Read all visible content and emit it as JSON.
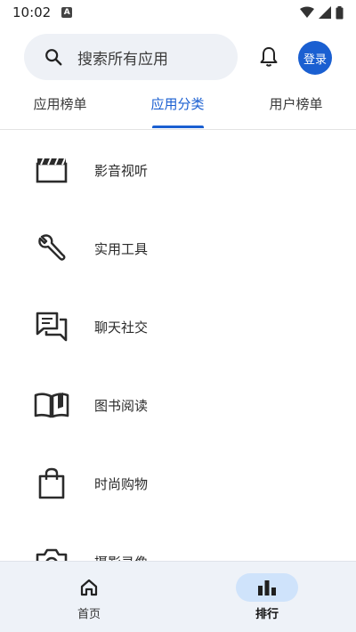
{
  "status_bar": {
    "time": "10:02",
    "notification_glyph": "A"
  },
  "search": {
    "placeholder_text": "搜索所有应用"
  },
  "header": {
    "login_label": "登录"
  },
  "tabs": [
    {
      "label": "应用榜单"
    },
    {
      "label": "应用分类",
      "selected": true
    },
    {
      "label": "用户榜单"
    }
  ],
  "categories": [
    {
      "label": "影音视听",
      "icon": "clapperboard-icon"
    },
    {
      "label": "实用工具",
      "icon": "wrench-icon"
    },
    {
      "label": "聊天社交",
      "icon": "chat-icon"
    },
    {
      "label": "图书阅读",
      "icon": "book-icon"
    },
    {
      "label": "时尚购物",
      "icon": "shopping-bag-icon"
    },
    {
      "label": "摄影录像",
      "icon": "camera-icon"
    }
  ],
  "bottom_nav": [
    {
      "label": "首页",
      "icon": "home-icon"
    },
    {
      "label": "排行",
      "icon": "bar-chart-icon",
      "selected": true
    }
  ],
  "colors": {
    "accent": "#1a5fd1",
    "nav_background": "#eef2f8",
    "nav_selected_pill": "#cfe3fb"
  }
}
